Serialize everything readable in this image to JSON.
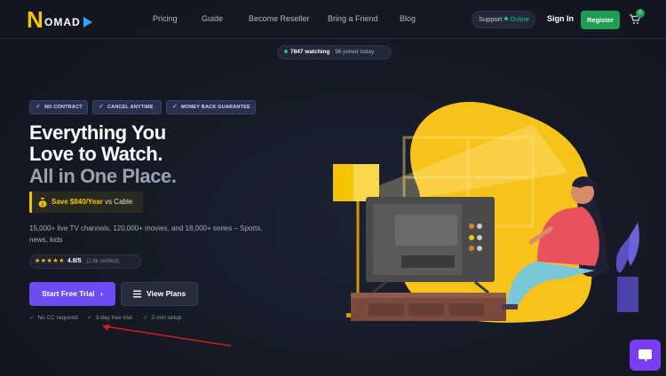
{
  "brand": {
    "logo_initial": "N",
    "logo_rest": "OMAD"
  },
  "nav": {
    "links": [
      "Pricing",
      "Guide",
      "Become Reseller",
      "Bring a Friend",
      "Blog"
    ],
    "support_label": "Support",
    "support_status": "Online",
    "signin_label": "Sign In",
    "register_label": "Register",
    "cart_count": "0"
  },
  "stats": {
    "watching": "7847 watching",
    "joined": "96 joined today"
  },
  "badges": [
    "NO CONTRACT",
    "CANCEL ANYTIME",
    "MONEY BACK GUARANTEE"
  ],
  "hero": {
    "line1": "Everything You",
    "line2": "Love to Watch.",
    "line3": "All in One Place.",
    "save_strong": "Save $840/Year",
    "save_rest": "vs Cable",
    "description": "15,000+ live TV channels, 120,000+ movies, and 18,000+ series – Sports, news, kids",
    "rating_stars": "★★★★★",
    "rating_score": "4.8/5",
    "rating_verified": "(2.8k verified)"
  },
  "cta": {
    "primary_label": "Start Free Trial",
    "secondary_label": "View Plans"
  },
  "perks": [
    "No CC required",
    "3-day free trial",
    "2-min setup"
  ],
  "colors": {
    "accent": "#6c4cf3",
    "brand_yellow": "#f5c400",
    "green": "#1f9d55",
    "background": "#161a26"
  }
}
